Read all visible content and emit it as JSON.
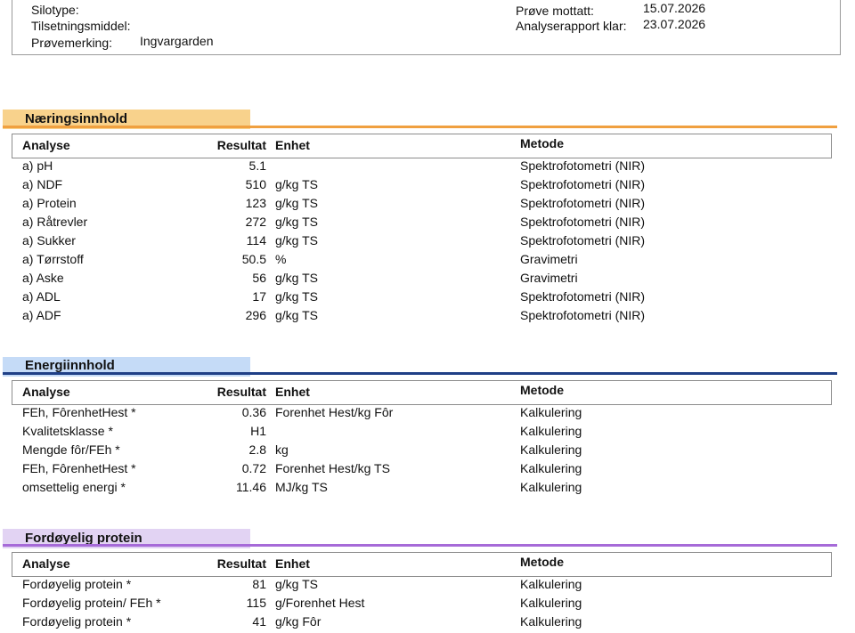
{
  "header": {
    "silotype_label": "Silotype:",
    "tilsetningsmiddel_label": "Tilsetningsmiddel:",
    "provemerking_label": "Prøvemerking:",
    "provemerking_value": "Ingvargarden",
    "prove_mottatt_label": "Prøve mottatt:",
    "prove_mottatt_value": "15.07.2026",
    "analyserapport_label": "Analyserapport klar:",
    "analyserapport_value": "23.07.2026"
  },
  "columns": {
    "analyse": "Analyse",
    "resultat": "Resultat",
    "enhet": "Enhet",
    "metode": "Metode"
  },
  "sections": [
    {
      "title": "Næringsinnhold",
      "band_color": "#f8d28c",
      "rule_color": "#f0a040",
      "rows": [
        {
          "analyse": "a) pH",
          "resultat": "5.1",
          "enhet": "",
          "metode": "Spektrofotometri (NIR)"
        },
        {
          "analyse": "a) NDF",
          "resultat": "510",
          "enhet": "g/kg TS",
          "metode": "Spektrofotometri (NIR)"
        },
        {
          "analyse": "a) Protein",
          "resultat": "123",
          "enhet": "g/kg TS",
          "metode": "Spektrofotometri (NIR)"
        },
        {
          "analyse": "a) Råtrevler",
          "resultat": "272",
          "enhet": "g/kg TS",
          "metode": "Spektrofotometri (NIR)"
        },
        {
          "analyse": "a) Sukker",
          "resultat": "114",
          "enhet": "g/kg TS",
          "metode": "Spektrofotometri (NIR)"
        },
        {
          "analyse": "a) Tørrstoff",
          "resultat": "50.5",
          "enhet": "%",
          "metode": "Gravimetri"
        },
        {
          "analyse": "a) Aske",
          "resultat": "56",
          "enhet": "g/kg TS",
          "metode": "Gravimetri"
        },
        {
          "analyse": "a) ADL",
          "resultat": "17",
          "enhet": "g/kg TS",
          "metode": "Spektrofotometri (NIR)"
        },
        {
          "analyse": "a) ADF",
          "resultat": "296",
          "enhet": "g/kg TS",
          "metode": "Spektrofotometri (NIR)"
        }
      ]
    },
    {
      "title": "Energiinnhold",
      "band_color": "#c5dbf7",
      "rule_color": "#1f3f86",
      "rows": [
        {
          "analyse": "FEh, FôrenhetHest *",
          "resultat": "0.36",
          "enhet": "Forenhet Hest/kg Fôr",
          "metode": "Kalkulering"
        },
        {
          "analyse": "Kvalitetsklasse *",
          "resultat": "H1",
          "enhet": "",
          "metode": "Kalkulering"
        },
        {
          "analyse": "Mengde fôr/FEh *",
          "resultat": "2.8",
          "enhet": "kg",
          "metode": "Kalkulering"
        },
        {
          "analyse": "FEh, FôrenhetHest *",
          "resultat": "0.72",
          "enhet": "Forenhet Hest/kg TS",
          "metode": "Kalkulering"
        },
        {
          "analyse": "omsettelig energi *",
          "resultat": "11.46",
          "enhet": "MJ/kg TS",
          "metode": "Kalkulering"
        }
      ]
    },
    {
      "title": "Fordøyelig protein",
      "band_color": "#e2d3f3",
      "rule_color": "#a66ad8",
      "rows": [
        {
          "analyse": "Fordøyelig protein *",
          "resultat": "81",
          "enhet": "g/kg TS",
          "metode": "Kalkulering"
        },
        {
          "analyse": "Fordøyelig protein/ FEh *",
          "resultat": "115",
          "enhet": "g/Forenhet Hest",
          "metode": "Kalkulering"
        },
        {
          "analyse": "Fordøyelig protein *",
          "resultat": "41",
          "enhet": "g/kg Fôr",
          "metode": "Kalkulering"
        }
      ]
    }
  ]
}
